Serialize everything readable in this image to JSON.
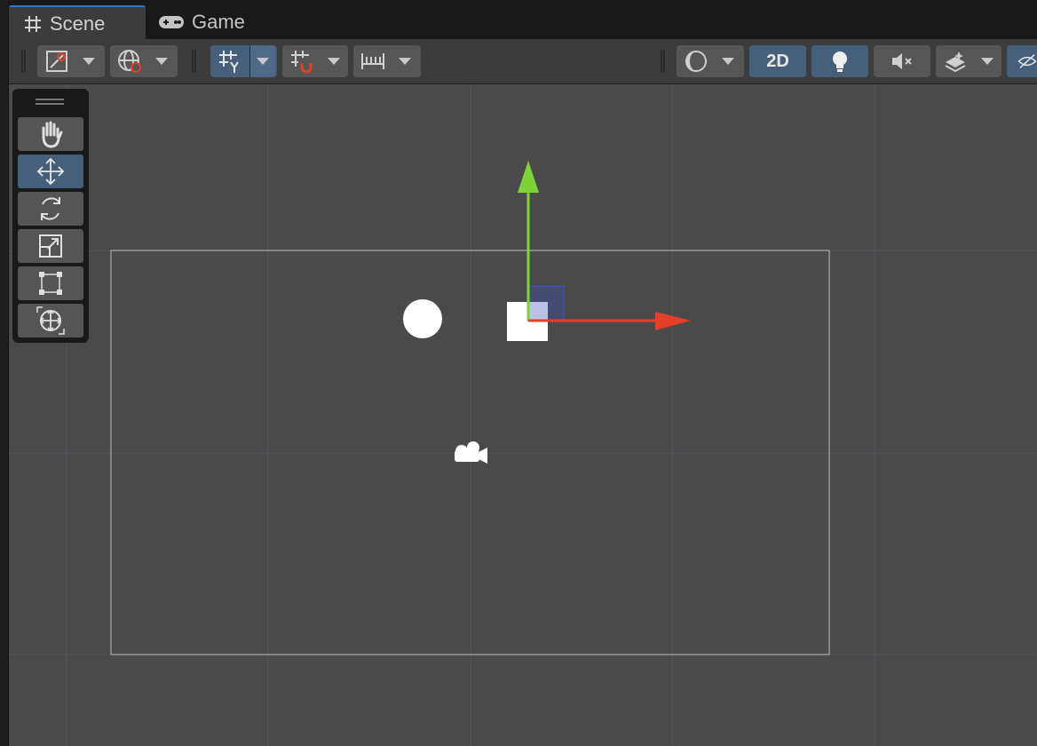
{
  "tabs": [
    {
      "label": "Scene",
      "icon": "grid-hash-icon",
      "active": true
    },
    {
      "label": "Game",
      "icon": "gamepad-icon",
      "active": false
    }
  ],
  "toolbar": {
    "mode_2d_label": "2D",
    "buttons": [
      {
        "name": "draw-mode-button",
        "icon": "draw-mode-icon"
      },
      {
        "name": "global-local-button",
        "icon": "globe-icon"
      },
      {
        "name": "grid-visibility-button",
        "icon": "grid-y-icon",
        "active": true
      },
      {
        "name": "grid-snapping-button",
        "icon": "grid-snap-icon"
      },
      {
        "name": "increment-snapping-button",
        "icon": "ruler-icon"
      },
      {
        "name": "render-mode-button",
        "icon": "sphere-icon"
      },
      {
        "name": "toggle-2d-button",
        "active": true
      },
      {
        "name": "lighting-button",
        "icon": "lightbulb-icon",
        "active": true
      },
      {
        "name": "audio-button",
        "icon": "audio-mute-icon"
      },
      {
        "name": "effects-button",
        "icon": "effects-layers-icon"
      },
      {
        "name": "hidden-objects-button",
        "icon": "eye-slash-icon",
        "active": true
      }
    ]
  },
  "tool_palette": [
    {
      "name": "hand-tool",
      "icon": "hand-icon",
      "active": false
    },
    {
      "name": "move-tool",
      "icon": "move-arrows-icon",
      "active": true
    },
    {
      "name": "rotate-tool",
      "icon": "rotate-icon",
      "active": false
    },
    {
      "name": "scale-tool",
      "icon": "scale-icon",
      "active": false
    },
    {
      "name": "rect-tool",
      "icon": "rect-transform-icon",
      "active": false
    },
    {
      "name": "transform-tool",
      "icon": "transform-icon",
      "active": false
    }
  ],
  "colors": {
    "accent_tab": "#3a79bb",
    "active_button": "#46607c",
    "gizmo_x": "#e3402a",
    "gizmo_y": "#7fd33a",
    "gizmo_z_plane": "#3f51b5"
  }
}
